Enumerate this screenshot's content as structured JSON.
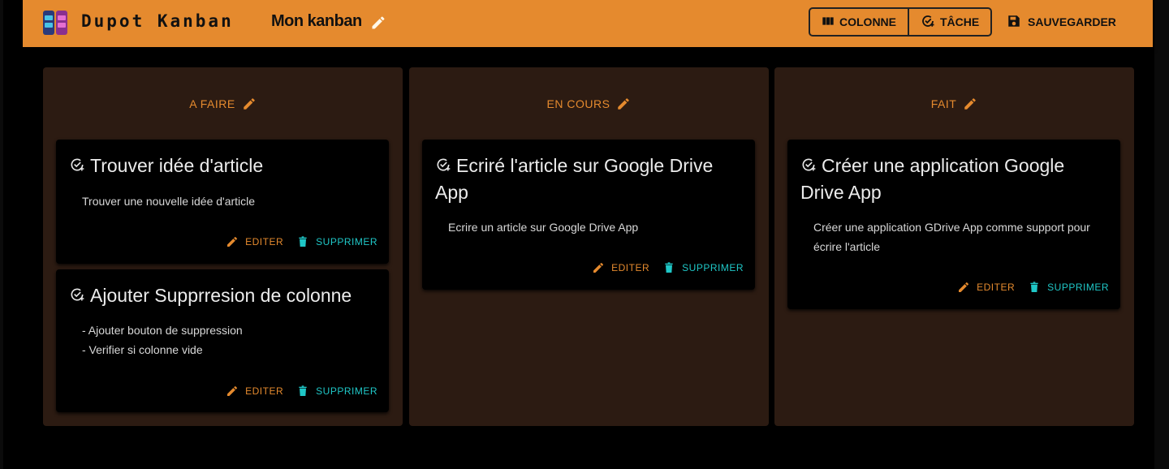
{
  "app": {
    "brand": "Dupot Kanban",
    "board_name": "Mon kanban",
    "buttons": {
      "column": "COLONNE",
      "task": "TÂCHE",
      "save": "SAUVEGARDER"
    }
  },
  "colors": {
    "accent": "#e58a2e",
    "delete": "#1fc7c7",
    "column_bg": "#2c1b12",
    "card_bg": "#000000"
  },
  "columns": [
    {
      "title": "A FAIRE",
      "cards": [
        {
          "title": "Trouver idée d'article",
          "description": "Trouver une nouvelle idée d'article",
          "edit": "EDITER",
          "delete": "SUPPRIMER"
        },
        {
          "title": "Ajouter Supprresion de colonne",
          "description": "- Ajouter bouton de suppression\n- Verifier si colonne vide",
          "edit": "EDITER",
          "delete": "SUPPRIMER"
        }
      ]
    },
    {
      "title": "EN COURS",
      "cards": [
        {
          "title": "Ecriré l'article sur Google Drive App",
          "description": "Ecrire un article sur Google Drive App",
          "edit": "EDITER",
          "delete": "SUPPRIMER"
        }
      ]
    },
    {
      "title": "FAIT",
      "cards": [
        {
          "title": "Créer une application Google Drive App",
          "description": "Créer une application GDrive App comme support pour écrire l'article",
          "edit": "EDITER",
          "delete": "SUPPRIMER"
        }
      ]
    }
  ]
}
